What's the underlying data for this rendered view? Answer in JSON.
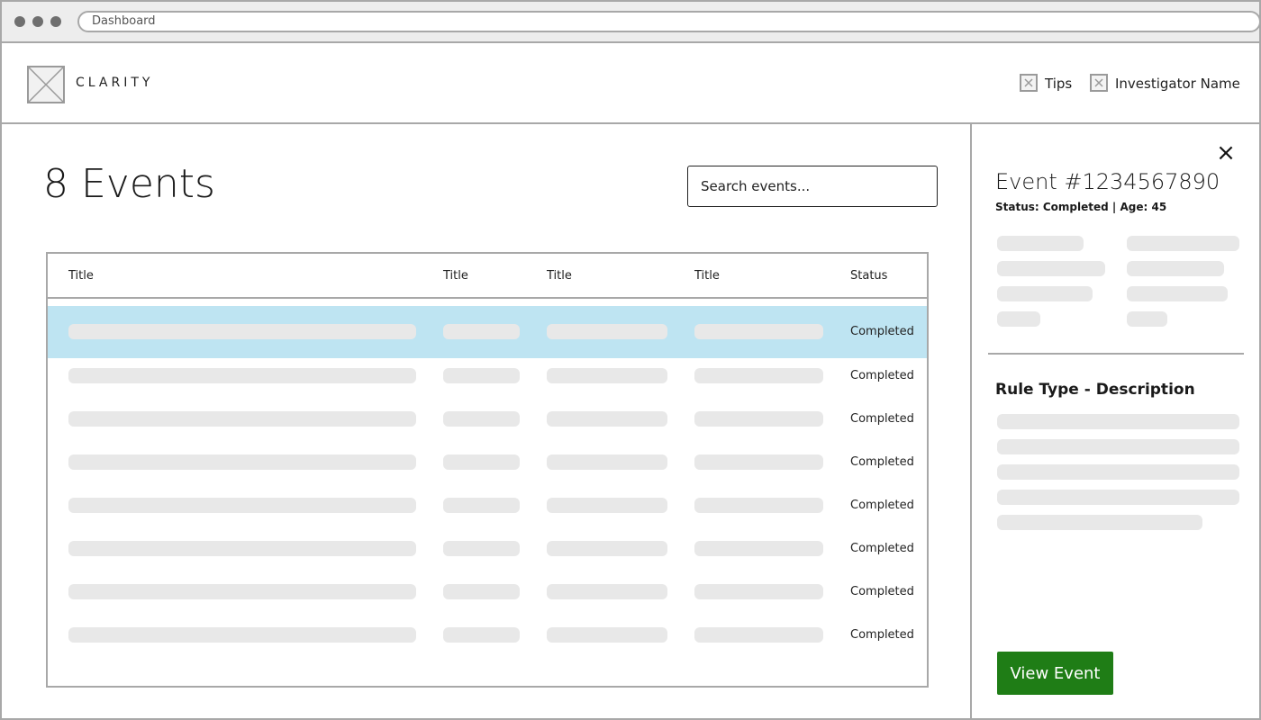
{
  "browser": {
    "url_text": "Dashboard"
  },
  "header": {
    "brand": "CLARITY",
    "tips_label": "Tips",
    "user_label": "Investigator Name"
  },
  "events": {
    "title": "8 Events",
    "search_placeholder": "Search events...",
    "columns": [
      "Title",
      "Title",
      "Title",
      "Title",
      "Status"
    ],
    "rows": [
      {
        "status": "Completed",
        "selected": true
      },
      {
        "status": "Completed"
      },
      {
        "status": "Completed"
      },
      {
        "status": "Completed"
      },
      {
        "status": "Completed"
      },
      {
        "status": "Completed"
      },
      {
        "status": "Completed"
      },
      {
        "status": "Completed"
      }
    ]
  },
  "detail": {
    "close_symbol": "×",
    "event_title": "Event #1234567890",
    "event_subtitle": "Status: Completed | Age: 45",
    "rule_heading": "Rule Type - Description",
    "view_button": "View Event"
  },
  "colors": {
    "selected_row": "#bee4f2",
    "primary_button": "#1f7d16",
    "placeholder_bar": "#e8e8e8"
  }
}
